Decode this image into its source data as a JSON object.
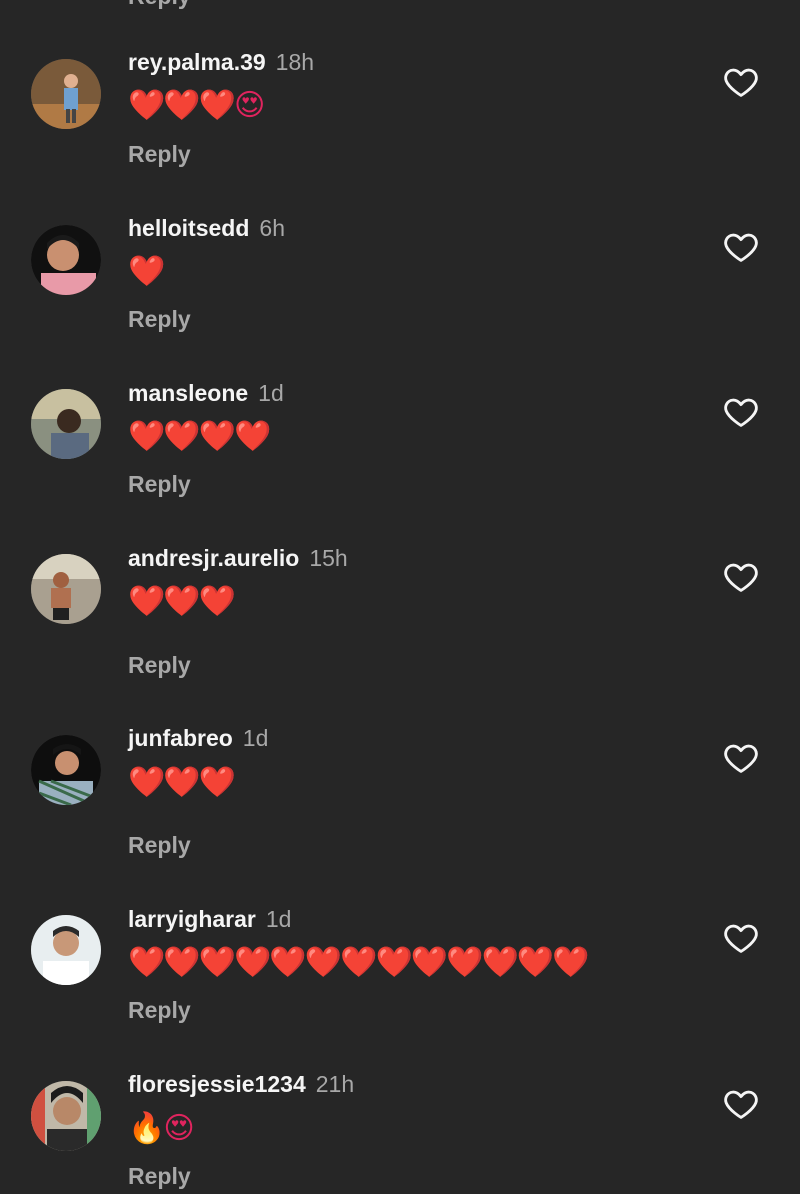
{
  "top_fragment": "Reply",
  "comments": [
    {
      "username": "rey.palma.39",
      "time": "18h",
      "text": "❤️❤️❤️😍",
      "reply": "Reply"
    },
    {
      "username": "helloitsedd",
      "time": "6h",
      "text": "❤️",
      "reply": "Reply"
    },
    {
      "username": "mansleone",
      "time": "1d",
      "text": "❤️❤️❤️❤️",
      "reply": "Reply"
    },
    {
      "username": "andresjr.aurelio",
      "time": "15h",
      "text": "❤️❤️❤️",
      "reply": "Reply"
    },
    {
      "username": "junfabreo",
      "time": "1d",
      "text": "❤️❤️❤️",
      "reply": "Reply"
    },
    {
      "username": "larryigharar",
      "time": "1d",
      "text": "❤️❤️❤️❤️❤️❤️❤️❤️❤️❤️❤️❤️❤️",
      "reply": "Reply"
    },
    {
      "username": "floresjessie1234",
      "time": "21h",
      "text": "🔥😍",
      "reply": "Reply"
    }
  ],
  "colors": {
    "background": "#262626",
    "username": "#f5f5f5",
    "secondary": "#a8a8a8",
    "heart": "#e0245e"
  },
  "icons": {
    "like": "heart-outline-icon"
  }
}
